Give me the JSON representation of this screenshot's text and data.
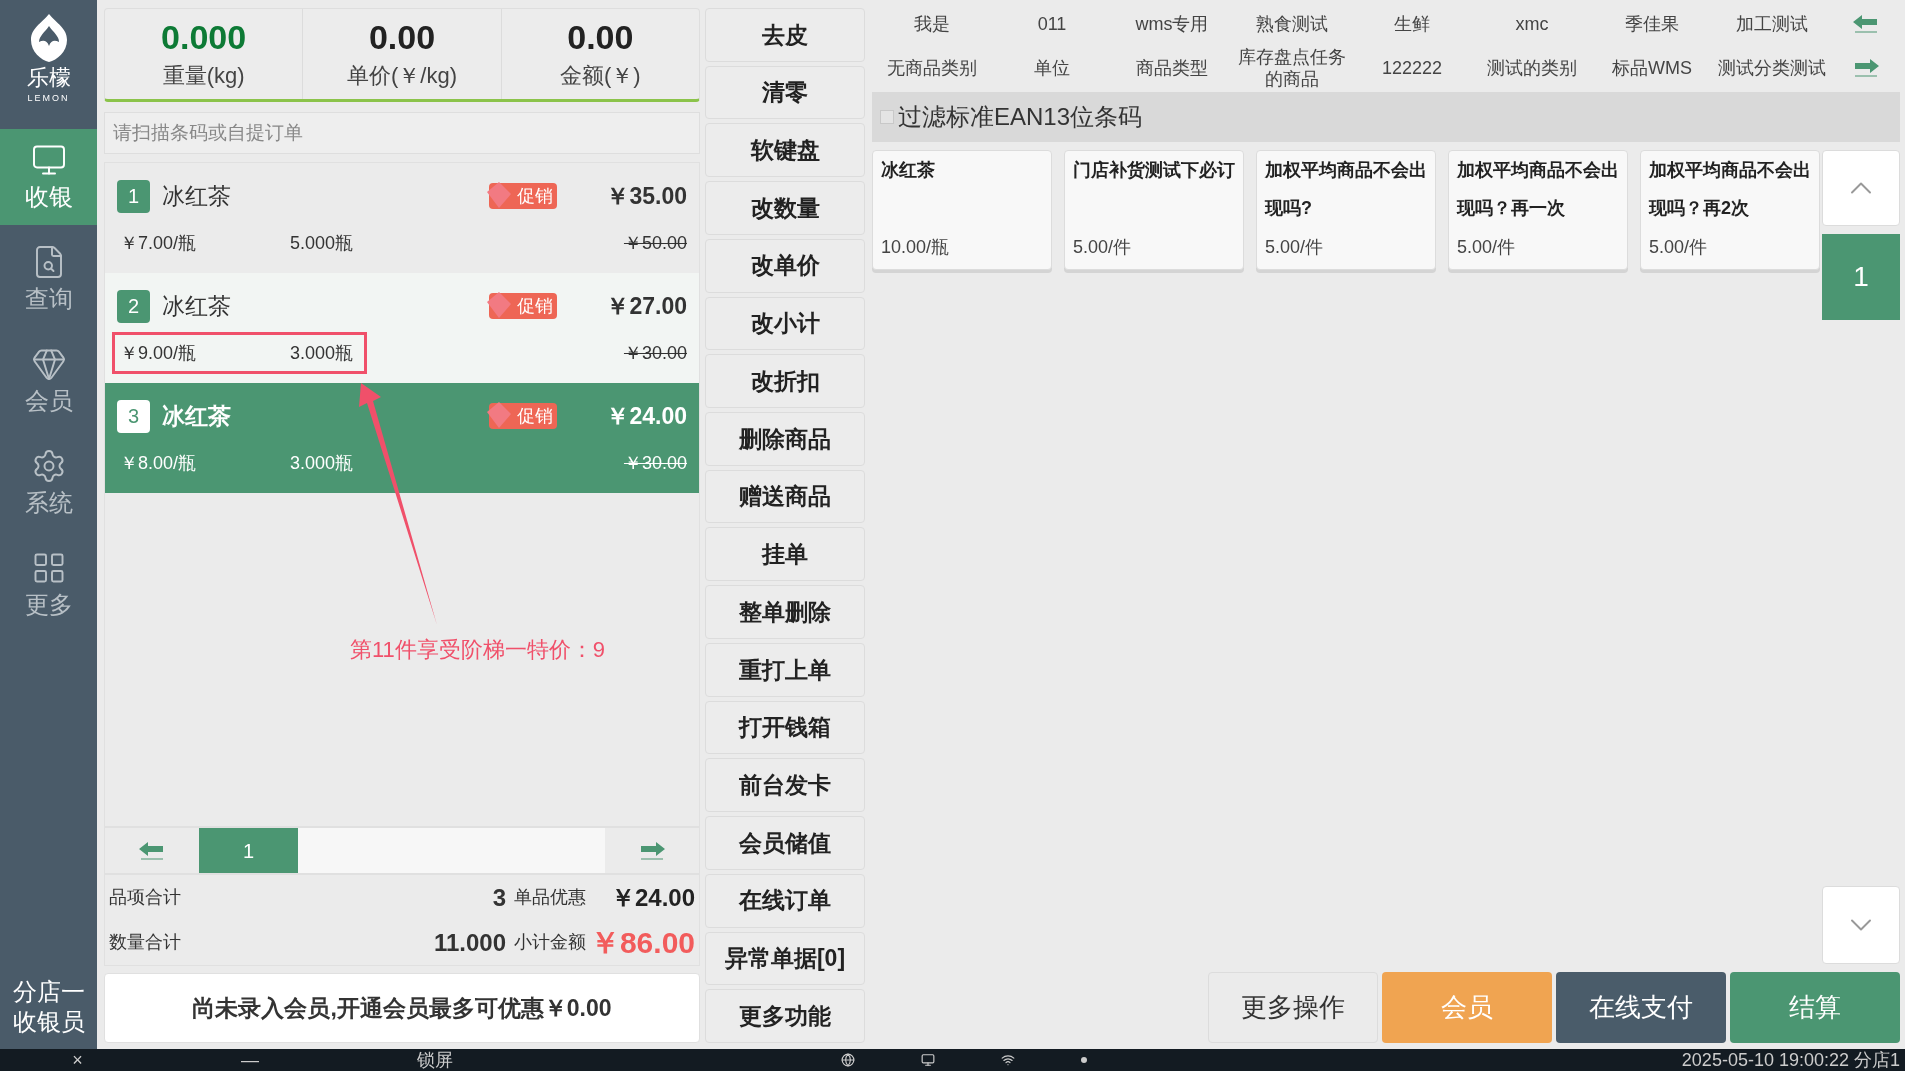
{
  "sidebar": {
    "brand": "乐檬",
    "brand_sub": "LEMON",
    "items": [
      {
        "label": "收银",
        "kind": "cashier",
        "selected": true
      },
      {
        "label": "查询",
        "kind": "query",
        "selected": false
      },
      {
        "label": "会员",
        "kind": "member",
        "selected": false
      },
      {
        "label": "系统",
        "kind": "settings",
        "selected": false
      },
      {
        "label": "更多",
        "kind": "more",
        "selected": false
      }
    ],
    "user": [
      "分店一",
      "收银员"
    ]
  },
  "scale": [
    {
      "value": "0.000",
      "label": "重量(kg)",
      "highlight": true
    },
    {
      "value": "0.00",
      "label": "单价(￥/kg)",
      "highlight": false
    },
    {
      "value": "0.00",
      "label": "金额(￥)",
      "highlight": false
    }
  ],
  "search": {
    "placeholder": "请扫描条码或自提订单"
  },
  "cart": [
    {
      "index": "1",
      "name": "冰红茶",
      "badge": "促销",
      "total": "￥35.00",
      "unit_price": "￥7.00/瓶",
      "qty": "5.000瓶",
      "original": "￥50.00",
      "selected": false,
      "highlighted": false
    },
    {
      "index": "2",
      "name": "冰红茶",
      "badge": "促销",
      "total": "￥27.00",
      "unit_price": "￥9.00/瓶",
      "qty": "3.000瓶",
      "original": "￥30.00",
      "selected": false,
      "highlighted": true
    },
    {
      "index": "3",
      "name": "冰红茶",
      "badge": "促销",
      "total": "￥24.00",
      "unit_price": "￥8.00/瓶",
      "qty": "3.000瓶",
      "original": "￥30.00",
      "selected": true,
      "highlighted": false
    }
  ],
  "annotation": "第11件享受阶梯一特价：9",
  "pager": {
    "page": "1"
  },
  "totals": [
    {
      "label": "品项合计",
      "value": "3",
      "label2": "单品优惠",
      "amount": "￥24.00",
      "emphasis": false
    },
    {
      "label": "数量合计",
      "value": "11.000",
      "label2": "小计金额",
      "amount": "￥86.00",
      "emphasis": true
    }
  ],
  "member_banner": "尚未录入会员,开通会员最多可优惠￥0.00",
  "actions": [
    "去皮",
    "清零",
    "软键盘",
    "改数量",
    "改单价",
    "改小计",
    "改折扣",
    "删除商品",
    "赠送商品",
    "挂单",
    "整单删除",
    "重打上单",
    "打开钱箱",
    "前台发卡",
    "会员储值",
    "在线订单",
    "异常单据[0]",
    "更多功能"
  ],
  "categories": [
    [
      "我是",
      "011",
      "wms专用",
      "熟食测试",
      "生鲜",
      "xmc",
      "季佳果",
      "加工测试"
    ],
    [
      "无商品类别",
      "单位",
      "商品类型",
      "库存盘点任务的商品",
      "122222",
      "测试的类别",
      "标品WMS",
      "测试分类测试"
    ]
  ],
  "filter": {
    "label": "过滤标准EAN13位条码",
    "checked": false
  },
  "products": [
    {
      "name": "冰红茶",
      "price": "10.00/瓶"
    },
    {
      "name": "门店补货测试下必订",
      "price": "5.00/件"
    },
    {
      "name": "加权平均商品不会出现吗?",
      "price": "5.00/件"
    },
    {
      "name": "加权平均商品不会出现吗？再一次",
      "price": "5.00/件"
    },
    {
      "name": "加权平均商品不会出现吗？再2次",
      "price": "5.00/件"
    }
  ],
  "product_page": "1",
  "bottom_buttons": [
    {
      "label": "更多操作",
      "kind": "plain"
    },
    {
      "label": "会员",
      "kind": "member"
    },
    {
      "label": "在线支付",
      "kind": "online"
    },
    {
      "label": "结算",
      "kind": "checkout"
    }
  ],
  "taskbar": {
    "close": "×",
    "minimize": "—",
    "lock": "锁屏",
    "datetime": "2025-05-10 19:00:22 分店1"
  }
}
